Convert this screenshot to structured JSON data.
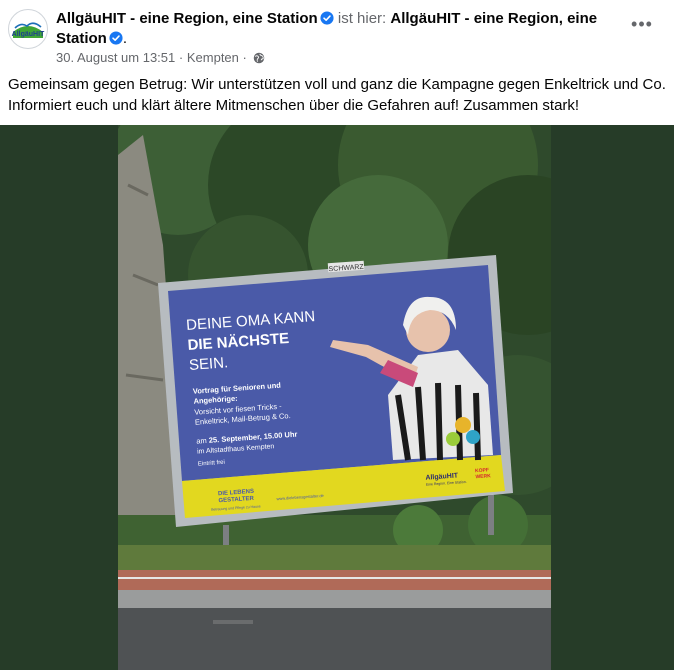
{
  "post": {
    "page_name": "AllgäuHIT - eine Region, eine Station",
    "relation": "ist hier:",
    "location_name_part1": "AllgäuHIT - eine Region, eine",
    "location_name_part2": "Station",
    "date": "30. August um 13:51",
    "place": "Kempten",
    "separator": "·",
    "text_line1": "Gemeinsam gegen Betrug: Wir unterstützen voll und ganz die Kampagne gegen Enkeltrick und Co.",
    "text_line2": "Informiert euch und klärt ältere Mitmenschen über die Gefahren auf! Zusammen stark!",
    "more_label": "•••"
  },
  "avatar": {
    "logo_text": "AllgäuHIT"
  },
  "icons": {
    "verified": "verified-badge-icon",
    "globe": "globe-icon",
    "more": "more-options-icon"
  },
  "poster": {
    "frame_label": "SCHWARZ",
    "headline1": "DEINE OMA KANN",
    "headline2": "DIE NÄCHSTE",
    "headline3": "SEIN.",
    "sub1": "Vortrag für Senioren und",
    "sub2": "Angehörige:",
    "sub3": "Vorsicht vor fiesen Tricks -",
    "sub4": "Enkeltrick, Mail-Betrug & Co.",
    "date_line_prefix": "am ",
    "date_line_bold": "25. September, 15.00 Uhr",
    "venue": "im Altstadthaus Kempten",
    "entry": "Eintritt frei",
    "sponsor1_line1": "DIE LEBENS",
    "sponsor1_line2": "GESTALTER",
    "sponsor1_small": "Betreuung und Pflege zu Hause",
    "url": "www.dielebensgestalter.de",
    "sponsor2": "AllgäuHIT",
    "sponsor2_small": "Eine Region. Eine Station.",
    "sponsor3_line1": "KOPF",
    "sponsor3_line2": "WERK"
  },
  "colors": {
    "photo_background": "#263c28",
    "poster_blue": "#4a5aa8",
    "poster_yellow": "#e2d81f",
    "verified_blue": "#1877f2"
  }
}
